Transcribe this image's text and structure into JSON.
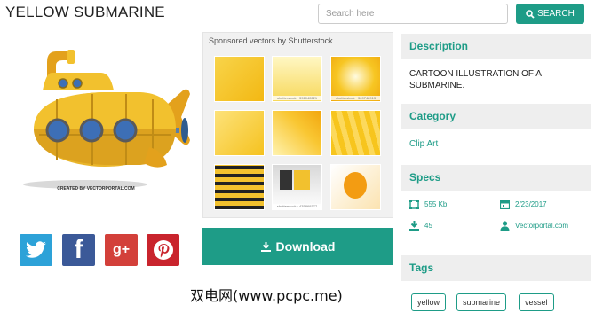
{
  "title": "YELLOW SUBMARINE",
  "search": {
    "placeholder": "Search here",
    "button_label": "SEARCH"
  },
  "sponsored": {
    "title": "Sponsored vectors by Shutterstock",
    "thumbs": [
      {
        "caption": ""
      },
      {
        "caption": "shutterstock · 392040221"
      },
      {
        "caption": "shutterstock · 369748913"
      },
      {
        "caption": ""
      },
      {
        "caption": ""
      },
      {
        "caption": ""
      },
      {
        "caption": ""
      },
      {
        "caption": "shutterstock · 435869377"
      },
      {
        "caption": ""
      }
    ]
  },
  "art": {
    "credit": "CREATED BY VECTORPORTAL.COM"
  },
  "download": {
    "label": "Download"
  },
  "social": {
    "gplus_label": "g+",
    "facebook_label": "f"
  },
  "description": {
    "heading": "Description",
    "text": "CARTOON ILLUSTRATION OF A SUBMARINE."
  },
  "category": {
    "heading": "Category",
    "value": "Clip Art"
  },
  "specs": {
    "heading": "Specs",
    "size": "555 Kb",
    "date": "2/23/2017",
    "downloads": "45",
    "author": "Vectorportal.com"
  },
  "tags": {
    "heading": "Tags",
    "items": [
      "yellow",
      "submarine",
      "vessel"
    ]
  },
  "watermark": "双电网(www.pcpc.me)",
  "colors": {
    "accent": "#1e9c87",
    "sub_yellow": "#f2c12e",
    "twitter": "#2da2d8",
    "facebook": "#3b5998",
    "gplus": "#d3403a",
    "pinterest": "#c9242d"
  }
}
